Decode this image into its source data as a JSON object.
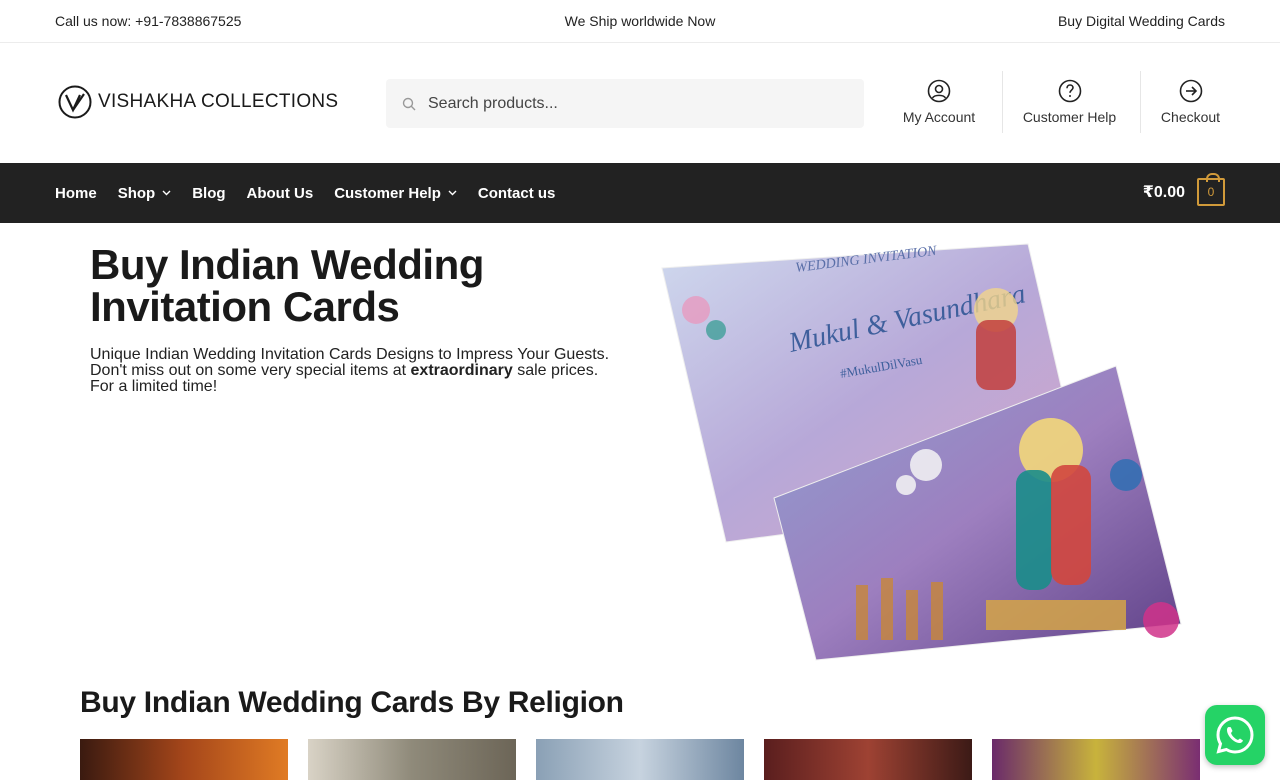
{
  "topbar": {
    "call": "Call us now: +91-7838867525",
    "ship": "We Ship worldwide Now",
    "digital_link": "Buy Digital Wedding Cards"
  },
  "header": {
    "logo_text": "VISHAKHA COLLECTIONS",
    "search_placeholder": "Search products...",
    "links": {
      "account": "My Account",
      "help": "Customer Help",
      "checkout": "Checkout"
    }
  },
  "nav": {
    "items": [
      "Home",
      "Shop",
      "Blog",
      "About Us",
      "Customer Help",
      "Contact us"
    ],
    "cart_total": "₹0.00",
    "cart_count": "0"
  },
  "hero": {
    "title": "Buy Indian Wedding Invitation Cards",
    "text_before": "Unique Indian Wedding Invitation Cards Designs to Impress Your Guests. Don't miss out on some very special items at ",
    "text_bold": "extraordinary",
    "text_after": " sale prices. For a limited time!",
    "card_names": "Mukul & Vasundhara",
    "card_header": "WEDDING INVITATION",
    "card_hashtag": "#MukulDilVasu"
  },
  "section": {
    "title": "Buy Indian Wedding Cards By Religion"
  },
  "colors": {
    "nav_bg": "#222222",
    "cart_accent": "#d19a3a",
    "whatsapp": "#25d366"
  }
}
